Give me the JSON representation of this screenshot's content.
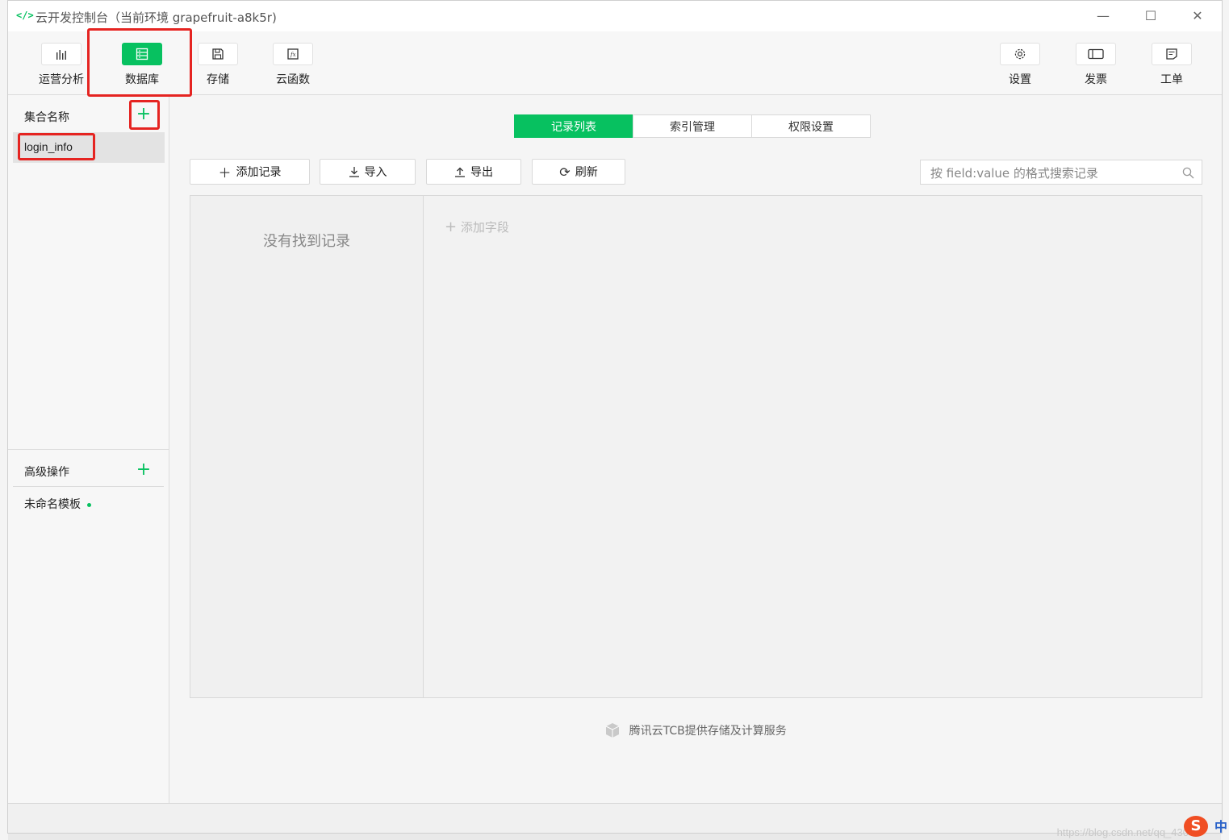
{
  "window": {
    "title": "云开发控制台（当前环境 grapefruit-a8k5r)",
    "app_icon": "</>",
    "minimize": "—",
    "maximize": "☐",
    "close": "✕"
  },
  "toolbar": {
    "left": [
      {
        "label": "运营分析",
        "icon": "bar-chart-icon"
      },
      {
        "label": "数据库",
        "icon": "database-icon",
        "active": true
      },
      {
        "label": "存储",
        "icon": "save-icon"
      },
      {
        "label": "云函数",
        "icon": "function-icon"
      }
    ],
    "right": [
      {
        "label": "设置",
        "icon": "gear-icon"
      },
      {
        "label": "发票",
        "icon": "invoice-icon"
      },
      {
        "label": "工单",
        "icon": "ticket-icon"
      }
    ]
  },
  "sidebar": {
    "collections_header": "集合名称",
    "add_symbol": "+",
    "collections": [
      "login_info"
    ],
    "advanced_header": "高级操作",
    "templates": [
      "未命名模板"
    ]
  },
  "tabs": [
    "记录列表",
    "索引管理",
    "权限设置"
  ],
  "actions": {
    "add_record": "添加记录",
    "import": "导入",
    "export": "导出",
    "refresh": "刷新"
  },
  "search": {
    "placeholder": "按 field:value 的格式搜索记录"
  },
  "records": {
    "empty": "没有找到记录",
    "add_field": "添加字段"
  },
  "footer": {
    "text": "腾讯云TCB提供存储及计算服务"
  },
  "overlay": {
    "watermark": "https://blog.csdn.net/qq_430",
    "ime": "中",
    "sogou": "S"
  },
  "colors": {
    "accent": "#07c160",
    "highlight": "#e52421"
  }
}
